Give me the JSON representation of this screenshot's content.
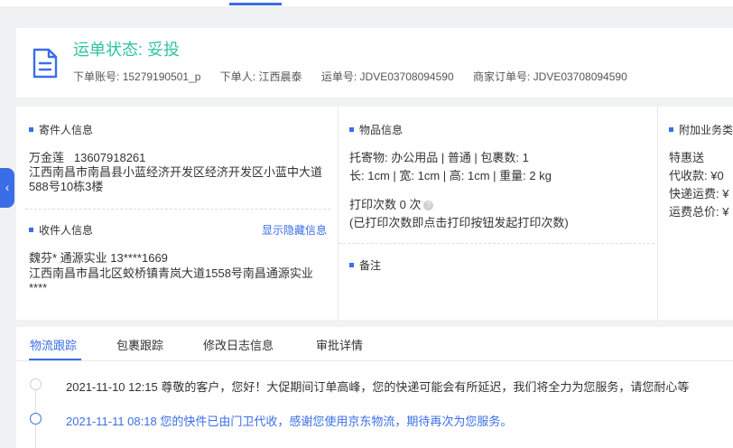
{
  "header": {
    "status_title": "运单状态: 妥投",
    "account_label": "下单账号:",
    "account_value": "15279190501_p",
    "orderer_label": "下单人:",
    "orderer_value": "江西晨泰",
    "waybill_label": "运单号:",
    "waybill_value": "JDVE03708094590",
    "merchant_order_label": "商家订单号:",
    "merchant_order_value": "JDVE03708094590"
  },
  "sender": {
    "title": "寄件人信息",
    "name": "万金莲",
    "phone": "13607918261",
    "address": "江西南昌市南昌县小蓝经济开发区经济开发区小蓝中大道588号10栋3楼"
  },
  "receiver": {
    "title": "收件人信息",
    "toggle_link": "显示隐藏信息",
    "contact": "魏芬* 通源实业 13****1669",
    "address": "江西南昌市昌北区蛟桥镇青岚大道1558号南昌通源实业****"
  },
  "goods": {
    "title": "物品信息",
    "line1": "托寄物:  办公用品 | 普通 | 包裹数:  1",
    "line2": "长:  1cm  |  宽:  1cm  |  高:  1cm  |  重量:  2 kg",
    "print_count": "打印次数   0 次",
    "print_hint": "(已打印次数即点击打印按钮发起打印次数)"
  },
  "remark": {
    "title": "备注"
  },
  "extra": {
    "title": "附加业务类",
    "item1": "特惠送",
    "item2": "代收款:  ¥0",
    "item3": "快递运费:  ¥",
    "item4": "运费总价:  ¥"
  },
  "side_tab": {
    "icon": "chevron-left-icon",
    "glyph": "‹"
  },
  "tabs": [
    "物流跟踪",
    "包裹跟踪",
    "修改日志信息",
    "审批详情"
  ],
  "timeline": [
    {
      "time": "2021-11-10 12:15",
      "text": "尊敬的客户，您好！大促期间订单高峰，您的快递可能会有所延迟，我们将全力为您服务，请您耐心等"
    },
    {
      "time": "2021-11-11 08:18",
      "text": "您的快件已由门卫代收，感谢您使用京东物流，期待再次为您服务。"
    }
  ],
  "colors": {
    "accent": "#3a6ee8",
    "status": "#2fc3a3"
  }
}
